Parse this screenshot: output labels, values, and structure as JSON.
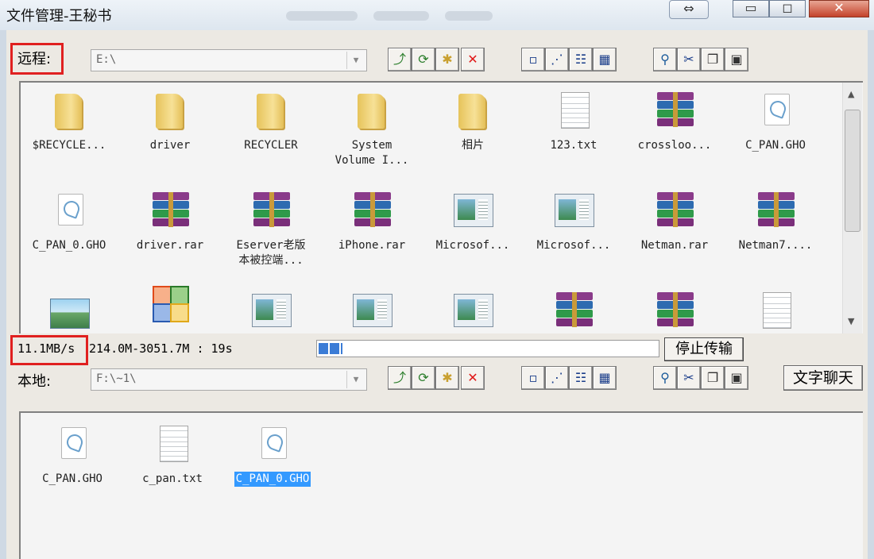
{
  "window": {
    "title": "文件管理-王秘书",
    "swap_glyph": "⇔",
    "min_glyph": "▭",
    "max_glyph": "◻",
    "close_glyph": "✕"
  },
  "remote": {
    "label": "远程:",
    "path": "E:\\",
    "files": [
      {
        "name": "$RECYCLE...",
        "icon": "folder-icon"
      },
      {
        "name": "driver",
        "icon": "folder-icon"
      },
      {
        "name": "RECYCLER",
        "icon": "folder-icon"
      },
      {
        "name": "System\nVolume I...",
        "icon": "folder-icon"
      },
      {
        "name": "相片",
        "icon": "folder-icon"
      },
      {
        "name": "123.txt",
        "icon": "text-file-icon"
      },
      {
        "name": "crossloo...",
        "icon": "rar-archive-icon"
      },
      {
        "name": "C_PAN.GHO",
        "icon": "ghost-image-icon"
      },
      {
        "name": "C_PAN_0.GHO",
        "icon": "ghost-image-icon"
      },
      {
        "name": "driver.rar",
        "icon": "rar-archive-icon"
      },
      {
        "name": "Eserver老版\n本被控端...",
        "icon": "rar-archive-icon"
      },
      {
        "name": "iPhone.rar",
        "icon": "rar-archive-icon"
      },
      {
        "name": "Microsof...",
        "icon": "window-app-icon"
      },
      {
        "name": "Microsof...",
        "icon": "window-app-icon"
      },
      {
        "name": "Netman.rar",
        "icon": "rar-archive-icon"
      },
      {
        "name": "Netman7....",
        "icon": "rar-archive-icon"
      },
      {
        "name": "",
        "icon": "image-file-icon"
      },
      {
        "name": "",
        "icon": "office-icon"
      },
      {
        "name": "",
        "icon": "window-app-icon"
      },
      {
        "name": "",
        "icon": "window-app-icon"
      },
      {
        "name": "",
        "icon": "window-app-icon"
      },
      {
        "name": "",
        "icon": "rar-archive-icon"
      },
      {
        "name": "",
        "icon": "rar-archive-icon"
      },
      {
        "name": "",
        "icon": "text-file-icon"
      }
    ]
  },
  "transfer": {
    "speed": "11.1MB/s",
    "stats": "214.0M-3051.7M : 19s",
    "progress_fraction": 0.07,
    "stop_label": "停止传输"
  },
  "local": {
    "label": "本地:",
    "path": "F:\\~1\\",
    "chat_label": "文字聊天",
    "files": [
      {
        "name": "C_PAN.GHO",
        "icon": "ghost-image-icon",
        "selected": false
      },
      {
        "name": "c_pan.txt",
        "icon": "text-file-icon",
        "selected": false
      },
      {
        "name": "C_PAN_0.GHO",
        "icon": "ghost-image-icon",
        "selected": true
      }
    ]
  },
  "toolbar_icons": [
    {
      "name": "up-folder-icon",
      "glyph": "⤴",
      "color": "#2a7d2a"
    },
    {
      "name": "refresh-icon",
      "glyph": "⟳",
      "color": "#2a7d2a"
    },
    {
      "name": "new-folder-icon",
      "glyph": "✱",
      "color": "#c9a030"
    },
    {
      "name": "delete-icon",
      "glyph": "✕",
      "color": "#e01818"
    },
    {
      "name": "large-icons-view-icon",
      "glyph": "▫",
      "color": "#1a3d8a"
    },
    {
      "name": "small-icons-view-icon",
      "glyph": "⋰",
      "color": "#1a3d8a"
    },
    {
      "name": "list-view-icon",
      "glyph": "☷",
      "color": "#1a3d8a"
    },
    {
      "name": "details-view-icon",
      "glyph": "▦",
      "color": "#1a3d8a"
    },
    {
      "name": "search-icon",
      "glyph": "⚲",
      "color": "#1a5a9a"
    },
    {
      "name": "cut-icon",
      "glyph": "✂",
      "color": "#1a3d8a"
    },
    {
      "name": "copy-icon",
      "glyph": "❐",
      "color": "#333"
    },
    {
      "name": "paste-icon",
      "glyph": "▣",
      "color": "#333"
    }
  ]
}
